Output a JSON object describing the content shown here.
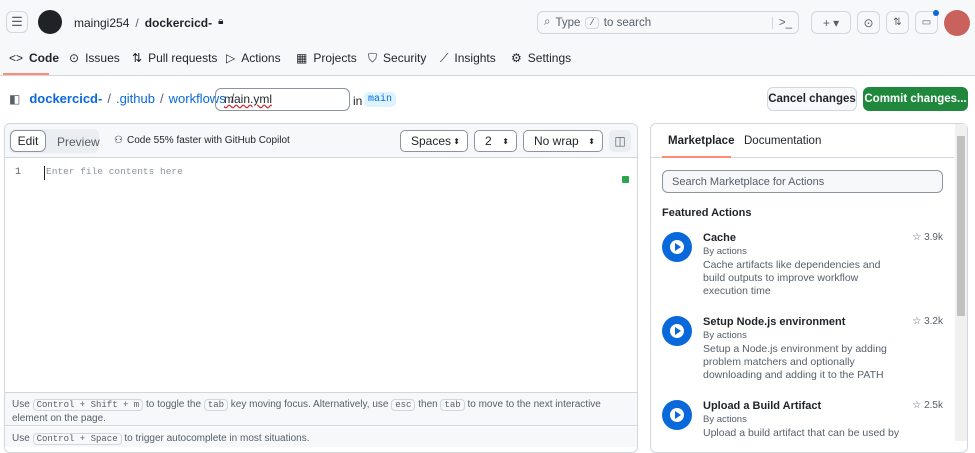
{
  "header": {
    "owner": "maingi254",
    "repo": "dockercicd-",
    "search_placeholder_pre": "Type",
    "search_key": "/",
    "search_placeholder_post": "to search"
  },
  "tabs": [
    {
      "label": "Code"
    },
    {
      "label": "Issues"
    },
    {
      "label": "Pull requests"
    },
    {
      "label": "Actions"
    },
    {
      "label": "Projects"
    },
    {
      "label": "Security"
    },
    {
      "label": "Insights"
    },
    {
      "label": "Settings"
    }
  ],
  "breadcrumb": {
    "repo": "dockercicd-",
    "sep": "/",
    "dir1": ".github",
    "dir2": "workflows",
    "filename": "main.yml",
    "in": "in",
    "branch": "main"
  },
  "buttons": {
    "cancel": "Cancel changes",
    "commit": "Commit changes..."
  },
  "editor": {
    "edit": "Edit",
    "preview": "Preview",
    "copilot": "Code 55% faster with GitHub Copilot",
    "indent": "Spaces",
    "size": "2",
    "wrap": "No wrap",
    "line_number": "1",
    "placeholder": "Enter file contents here"
  },
  "help": {
    "use": "Use",
    "k1": "Control + Shift + m",
    "t1": "to toggle the",
    "k2": "tab",
    "t2": "key moving focus. Alternatively, use",
    "k3": "esc",
    "t3": "then",
    "k4": "tab",
    "t4": "to move to the next interactive element on the page.",
    "use2": "Use",
    "k5": "Control + Space",
    "t5": "to trigger autocomplete in most situations."
  },
  "panel": {
    "tabs": [
      "Marketplace",
      "Documentation"
    ],
    "search_placeholder": "Search Marketplace for Actions",
    "featured": "Featured Actions",
    "actions": [
      {
        "title": "Cache",
        "by": "By actions",
        "desc": "Cache artifacts like dependencies and build outputs to improve workflow execution time",
        "stars": "3.9k"
      },
      {
        "title": "Setup Node.js environment",
        "by": "By actions",
        "desc": "Setup a Node.js environment by adding problem matchers and optionally downloading and adding it to the PATH",
        "stars": "3.2k"
      },
      {
        "title": "Upload a Build Artifact",
        "by": "By actions",
        "desc": "Upload a build artifact that can be used by",
        "stars": "2.5k"
      }
    ]
  },
  "colors": {
    "accent": "#0969da",
    "commit": "#1f883d",
    "tab_underline": "#fd8c73"
  }
}
